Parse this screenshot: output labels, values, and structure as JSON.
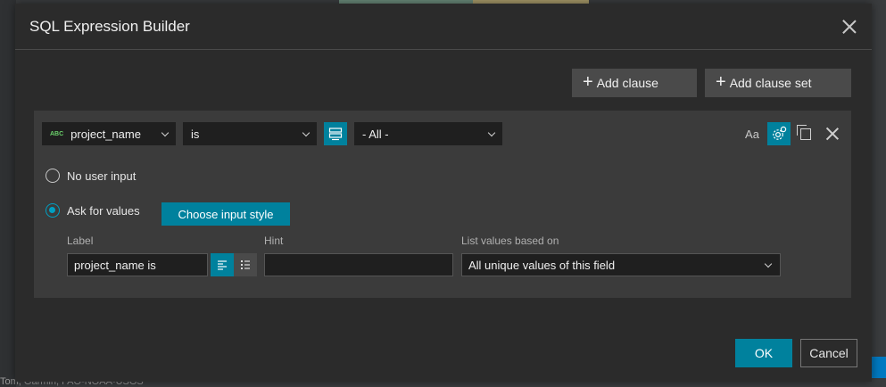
{
  "background": {
    "attribution": "Tom, Garmin, FAO-NOAA-USGS"
  },
  "modal": {
    "title": "SQL Expression Builder"
  },
  "toolbar": {
    "add_clause": "Add clause",
    "add_clause_set": "Add clause set"
  },
  "clause": {
    "field_type_badge": "ABC",
    "field_value": "project_name",
    "operator_value": "is",
    "value_selected": "- All -",
    "case_label": "Aa",
    "options": {
      "no_input": "No user input",
      "ask_values": "Ask for values",
      "selected": "ask_values"
    },
    "choose_input_style": "Choose input style",
    "label_caption": "Label",
    "label_value": "project_name is",
    "hint_caption": "Hint",
    "hint_value": "",
    "list_caption": "List values based on",
    "list_value": "All unique values of this field"
  },
  "footer": {
    "ok": "OK",
    "cancel": "Cancel"
  },
  "colors": {
    "accent": "#00819d",
    "panel": "#3b3b3b",
    "modal": "#2b2b2b"
  }
}
